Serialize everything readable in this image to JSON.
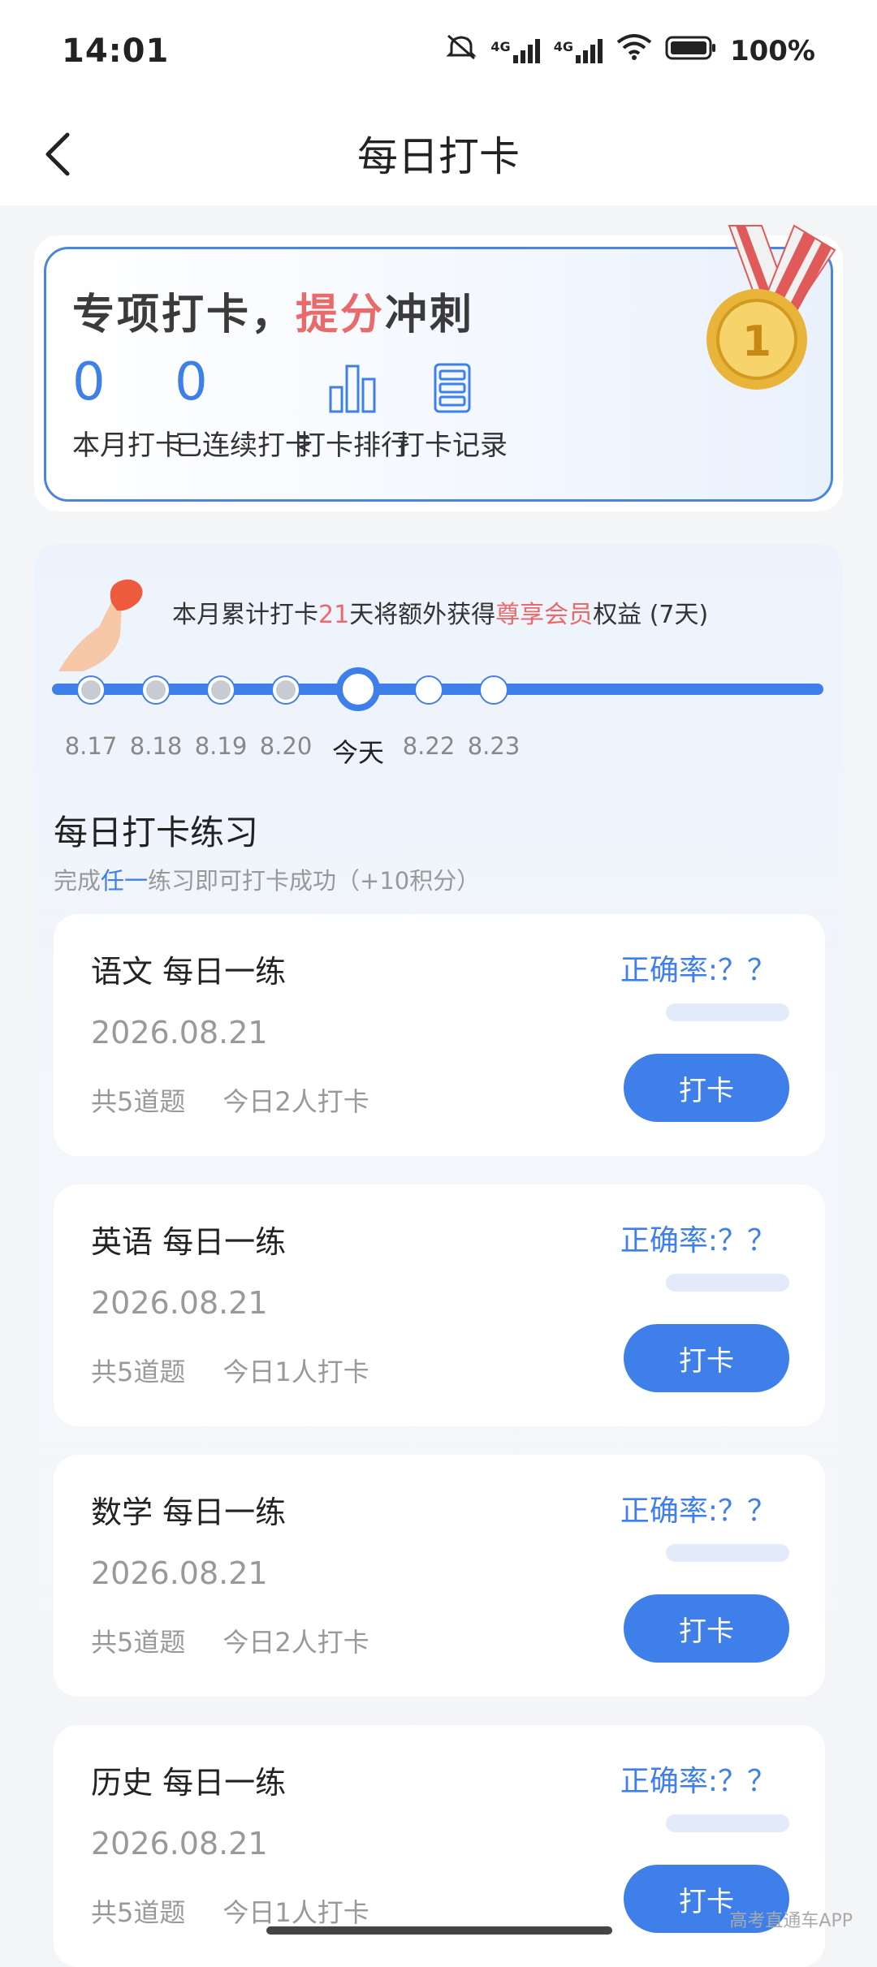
{
  "status": {
    "time": "14:01",
    "battery": "100%",
    "network1": "4G",
    "network2": "4G"
  },
  "nav": {
    "title": "每日打卡"
  },
  "hero": {
    "title_part1": "专项打卡，",
    "title_highlight": "提分",
    "title_part2": "冲刺",
    "stats": [
      {
        "num": "0",
        "label": "本月打卡"
      },
      {
        "num": "0",
        "label": "已连续打卡"
      }
    ],
    "links": [
      {
        "label": "打卡排行",
        "icon": "bar-chart-icon"
      },
      {
        "label": "打卡记录",
        "icon": "record-list-icon"
      }
    ],
    "colors": {
      "accent": "#3f7fea",
      "highlight": "#e86a6a"
    }
  },
  "promo": {
    "part1": "本月累计打卡",
    "days": "21",
    "part2": "天将额外获得",
    "vip": "尊享会员",
    "part3": "权益 (7天)"
  },
  "timeline": {
    "days": [
      "8.17",
      "8.18",
      "8.19",
      "8.20",
      "今天",
      "8.22",
      "8.23"
    ]
  },
  "section": {
    "title": "每日打卡练习",
    "sub1": "完成",
    "sub_blue": "任一",
    "sub2": "练习即可打卡成功（+10积分）"
  },
  "cards": [
    {
      "title": "语文 每日一练",
      "date": "2026.08.21",
      "count": "共5道题",
      "today": "今日2人打卡",
      "accuracy": "正确率:？？",
      "button": "打卡"
    },
    {
      "title": "英语 每日一练",
      "date": "2026.08.21",
      "count": "共5道题",
      "today": "今日1人打卡",
      "accuracy": "正确率:？？",
      "button": "打卡"
    },
    {
      "title": "数学 每日一练",
      "date": "2026.08.21",
      "count": "共5道题",
      "today": "今日2人打卡",
      "accuracy": "正确率:？？",
      "button": "打卡"
    },
    {
      "title": "历史 每日一练",
      "date": "2026.08.21",
      "count": "共5道题",
      "today": "今日1人打卡",
      "accuracy": "正确率:？？",
      "button": "打卡"
    }
  ],
  "watermark": "高考直通车APP"
}
